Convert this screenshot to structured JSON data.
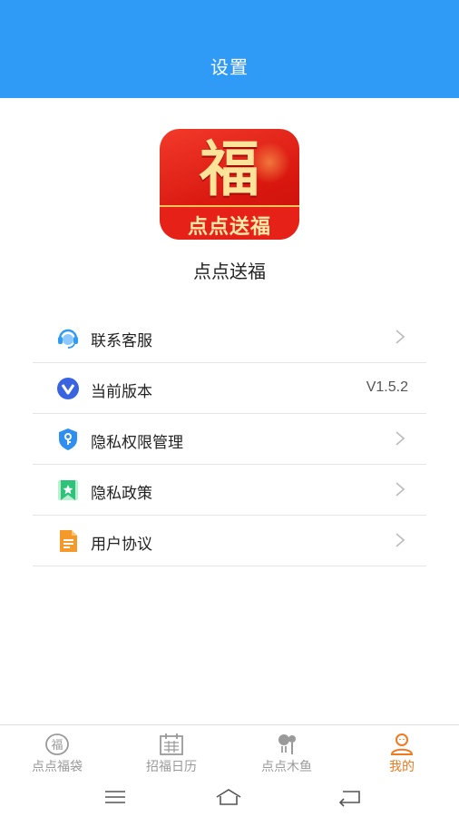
{
  "header": {
    "title": "设置"
  },
  "app": {
    "logo_char": "福",
    "logo_banner": "点点送福",
    "name": "点点送福"
  },
  "menu": [
    {
      "label": "联系客服",
      "icon": "headset-icon",
      "has_chevron": true
    },
    {
      "label": "当前版本",
      "icon": "version-icon",
      "value": "V1.5.2"
    },
    {
      "label": "隐私权限管理",
      "icon": "shield-icon",
      "has_chevron": true
    },
    {
      "label": "隐私政策",
      "icon": "bookmark-icon",
      "has_chevron": true
    },
    {
      "label": "用户协议",
      "icon": "document-icon",
      "has_chevron": true
    }
  ],
  "tabs": [
    {
      "label": "点点福袋",
      "icon": "fu-bag-icon",
      "active": false
    },
    {
      "label": "招福日历",
      "icon": "calendar-icon",
      "active": false
    },
    {
      "label": "点点木鱼",
      "icon": "muyu-icon",
      "active": false
    },
    {
      "label": "我的",
      "icon": "profile-icon",
      "active": true
    }
  ],
  "colors": {
    "header_bg": "#2f9bf6",
    "active_tab": "#f07a20",
    "inactive_tab": "#9a9a9a"
  }
}
